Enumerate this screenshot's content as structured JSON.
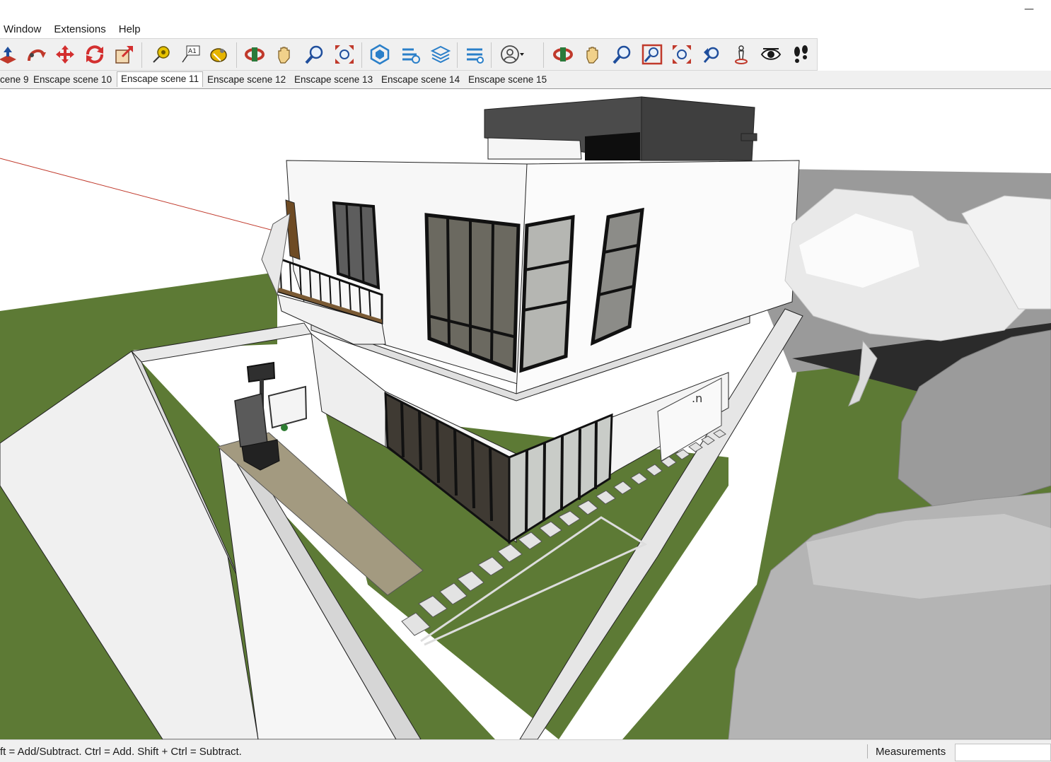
{
  "window": {
    "minimize_glyph": "—"
  },
  "menu": {
    "items": [
      {
        "label": "Window"
      },
      {
        "label": "Extensions"
      },
      {
        "label": "Help"
      }
    ]
  },
  "toolbar": {
    "tools": [
      {
        "icon": "push-pull-icon",
        "color": "#c0392b"
      },
      {
        "icon": "follow-me-icon",
        "color": "#c0392b"
      },
      {
        "icon": "move-icon",
        "color": "#d32f2f"
      },
      {
        "icon": "rotate-icon",
        "color": "#d32f2f"
      },
      {
        "icon": "scale-icon",
        "color": "#d32f2f"
      },
      {
        "icon": "tape-measure-icon",
        "color": "#d4b200"
      },
      {
        "icon": "text-icon",
        "text": "A1"
      },
      {
        "icon": "paint-bucket-icon",
        "color": "#e5b400"
      },
      {
        "icon": "orbit-icon",
        "color": "#c0392b"
      },
      {
        "icon": "pan-icon",
        "color": "#f1d18a"
      },
      {
        "icon": "zoom-icon",
        "color": "#1f4e9c"
      },
      {
        "icon": "zoom-extents-icon",
        "color": "#c0392b"
      },
      {
        "icon": "enscape-start-icon",
        "color": "#2a7fc9"
      },
      {
        "icon": "enscape-sync-icon",
        "color": "#2a7fc9"
      },
      {
        "icon": "enscape-layers-icon",
        "color": "#2a7fc9"
      },
      {
        "icon": "enscape-settings-icon",
        "color": "#2a7fc9"
      },
      {
        "icon": "user-account-icon",
        "color": "#4a4a4a"
      },
      {
        "icon": "orbit-icon",
        "color": "#c0392b"
      },
      {
        "icon": "pan-icon",
        "color": "#f1d18a"
      },
      {
        "icon": "zoom-icon",
        "color": "#1f4e9c"
      },
      {
        "icon": "zoom-window-icon",
        "color": "#c0392b"
      },
      {
        "icon": "zoom-extents-icon",
        "color": "#c0392b"
      },
      {
        "icon": "previous-view-icon",
        "color": "#1f4e9c"
      },
      {
        "icon": "position-camera-icon",
        "color": "#c0392b"
      },
      {
        "icon": "look-around-icon",
        "color": "#1a1a1a"
      },
      {
        "icon": "walk-icon",
        "color": "#1a1a1a"
      }
    ]
  },
  "scenes": {
    "tabs": [
      {
        "label": "cene 9"
      },
      {
        "label": "Enscape scene 10"
      },
      {
        "label": "Enscape scene 11",
        "active": true
      },
      {
        "label": "Enscape scene 12"
      },
      {
        "label": "Enscape scene 13"
      },
      {
        "label": "Enscape scene 14"
      },
      {
        "label": "Enscape scene 15"
      }
    ]
  },
  "model": {
    "label_text": ".n",
    "colors": {
      "grass": "#5d7a35",
      "wall": "#f4f4f4",
      "path": "#a39a80",
      "frame": "#1a1a1a",
      "roof": "#4b4b4b",
      "axis": "#c0392b"
    }
  },
  "status": {
    "hint": "ft = Add/Subtract. Ctrl = Add. Shift + Ctrl = Subtract.",
    "measurements_label": "Measurements",
    "measurements_value": ""
  }
}
